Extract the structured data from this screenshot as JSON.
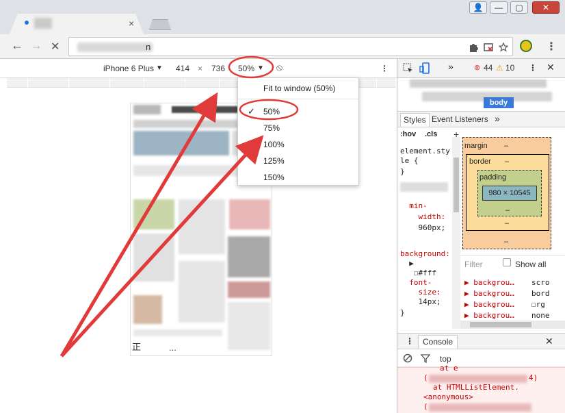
{
  "browser": {
    "tab_close": "×",
    "url_suffix": "n",
    "back": "←",
    "forward": "→",
    "stop": "✕",
    "menu": "⋮",
    "window_buttons": [
      "👤",
      "—",
      "▢",
      "✕"
    ]
  },
  "device_toolbar": {
    "device": "iPhone 6 Plus",
    "device_arrow": "▼",
    "width": "414",
    "times": "×",
    "height": "736",
    "zoom": "50%",
    "zoom_arrow": "▼",
    "rotate": "⦸",
    "more": "⋮"
  },
  "zoom_menu": {
    "fit": "Fit to window (50%)",
    "checkmark": "✓",
    "options": [
      "50%",
      "75%",
      "100%",
      "125%",
      "150%"
    ],
    "selected": "50%"
  },
  "phone_page": {
    "footer_text": "正",
    "footer_dots": "..."
  },
  "devtools": {
    "more_tabs": "»",
    "error_count": "44",
    "warning_count": "10",
    "menu": "⋮",
    "close": "✕",
    "body_tag": "body",
    "subtabs": [
      "Styles",
      "Event Listeners"
    ],
    "subtabs_more": "»",
    "hov": ":hov",
    "cls": ".cls",
    "add": "+",
    "style_lines": [
      "element.sty",
      "le {",
      "}",
      "",
      "  min-",
      "    width:",
      "    960px;",
      "",
      "",
      "background:",
      "  ▶",
      "   ☐#fff",
      "  font-",
      "    size:",
      "    14px;",
      "}"
    ],
    "box_model": {
      "margin": "margin",
      "border": "border",
      "padding": "padding",
      "content": "980 × 10545",
      "dash": "–"
    },
    "filter_placeholder": "Filter",
    "show_all": "Show all",
    "computed_props": [
      {
        "name": "▶ backgrou…",
        "value": "scro"
      },
      {
        "name": "▶ backgrou…",
        "value": "bord"
      },
      {
        "name": "▶ backgrou…",
        "value": "☐rg"
      },
      {
        "name": "▶ backgrou…",
        "value": "none"
      }
    ],
    "console_tab": "Console",
    "console_menu": "⋮",
    "console_close": "✕",
    "console_context": "top",
    "console_lines": [
      "at e",
      "(",
      "4)",
      "at HTMLListElement.",
      "<anonymous>",
      "("
    ]
  }
}
